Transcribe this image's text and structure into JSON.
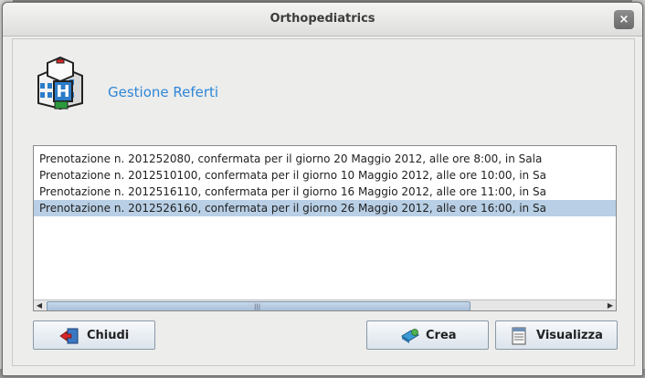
{
  "window": {
    "title": "Orthopediatrics",
    "close_glyph": "×"
  },
  "header": {
    "title": "Gestione Referti",
    "logo_letter": "H"
  },
  "list": {
    "items": [
      "Prenotazione n. 201252080, confermata per il giorno 20 Maggio 2012, alle ore 8:00, in Sala",
      "Prenotazione n. 2012510100, confermata per il giorno 10 Maggio 2012, alle ore 10:00, in Sa",
      "Prenotazione n. 2012516110, confermata per il giorno 16 Maggio 2012, alle ore 11:00, in Sa",
      "Prenotazione n. 2012526160, confermata per il giorno 26 Maggio 2012, alle ore 16:00, in Sa"
    ],
    "selected_index": 3,
    "scroll_arrow_left": "◀",
    "scroll_arrow_right": "▶",
    "scroll_grip": "|||"
  },
  "buttons": {
    "close_label": "Chiudi",
    "create_label": "Crea",
    "view_label": "Visualizza"
  },
  "icons": {
    "close_button_icon": "exit-door-icon",
    "create_button_icon": "create-document-icon",
    "view_button_icon": "report-document-icon",
    "logo": "hospital-building-icon"
  },
  "colors": {
    "accent": "#2f86d6",
    "selection": "#b8cfe5"
  }
}
